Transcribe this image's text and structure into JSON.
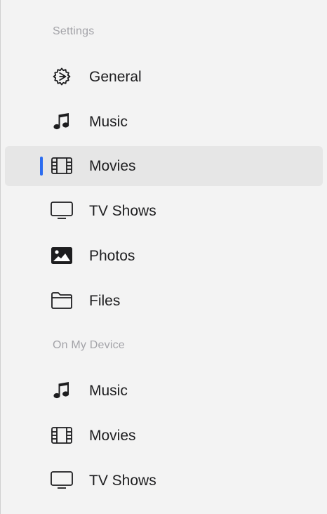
{
  "sidebar": {
    "settings_header": "Settings",
    "device_header": "On My Device",
    "accent_color": "#2b6cf0",
    "settings_items": [
      {
        "label": "General",
        "icon": "gear-icon",
        "selected": false
      },
      {
        "label": "Music",
        "icon": "music-note-icon",
        "selected": false
      },
      {
        "label": "Movies",
        "icon": "film-icon",
        "selected": true
      },
      {
        "label": "TV Shows",
        "icon": "tv-icon",
        "selected": false
      },
      {
        "label": "Photos",
        "icon": "photo-icon",
        "selected": false
      },
      {
        "label": "Files",
        "icon": "folder-icon",
        "selected": false
      }
    ],
    "device_items": [
      {
        "label": "Music",
        "icon": "music-note-icon",
        "selected": false
      },
      {
        "label": "Movies",
        "icon": "film-icon",
        "selected": false
      },
      {
        "label": "TV Shows",
        "icon": "tv-icon",
        "selected": false
      }
    ]
  }
}
